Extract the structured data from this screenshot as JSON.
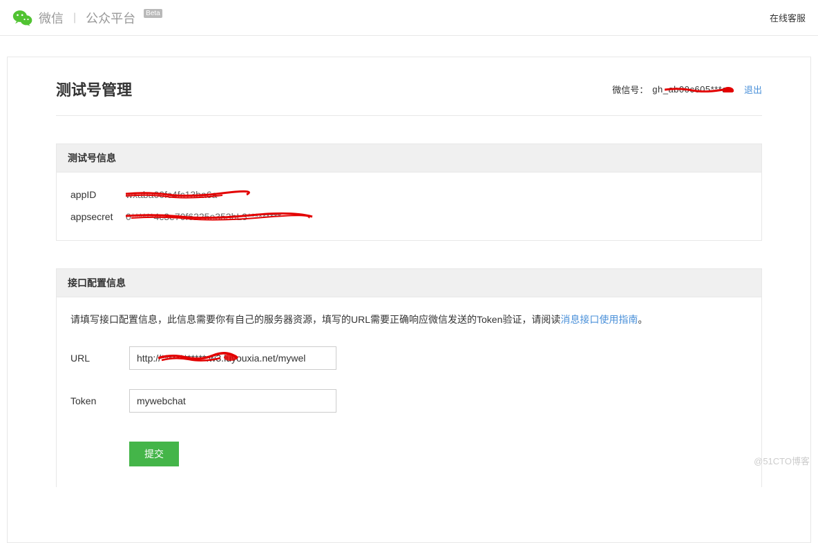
{
  "header": {
    "brand_wechat": "微信",
    "brand_platform": "公众平台",
    "beta_badge": "Beta",
    "online_help": "在线客服"
  },
  "page": {
    "title": "测试号管理",
    "account_prefix": "微信号：",
    "account_value": "gh_ab00c605***a",
    "logout": "退出"
  },
  "panels": {
    "info": {
      "title": "测试号信息",
      "rows": [
        {
          "label": "appID",
          "value": "wxaba00fc4fc13ba6a"
        },
        {
          "label": "appsecret",
          "value": "0******4c3e70f6225e353bL3*********"
        }
      ]
    },
    "config": {
      "title": "接口配置信息",
      "desc_prefix": "请填写接口配置信息，此信息需要你有自己的服务器资源，填写的URL需要正确响应微信发送的Token验证，请阅读",
      "guide_link": "消息接口使用指南",
      "desc_suffix": "。",
      "fields": {
        "url_label": "URL",
        "url_value": "http://************.w3.luyouxia.net/mywel",
        "token_label": "Token",
        "token_value": "mywebchat"
      },
      "submit": "提交"
    }
  },
  "watermark": "@51CTO博客"
}
